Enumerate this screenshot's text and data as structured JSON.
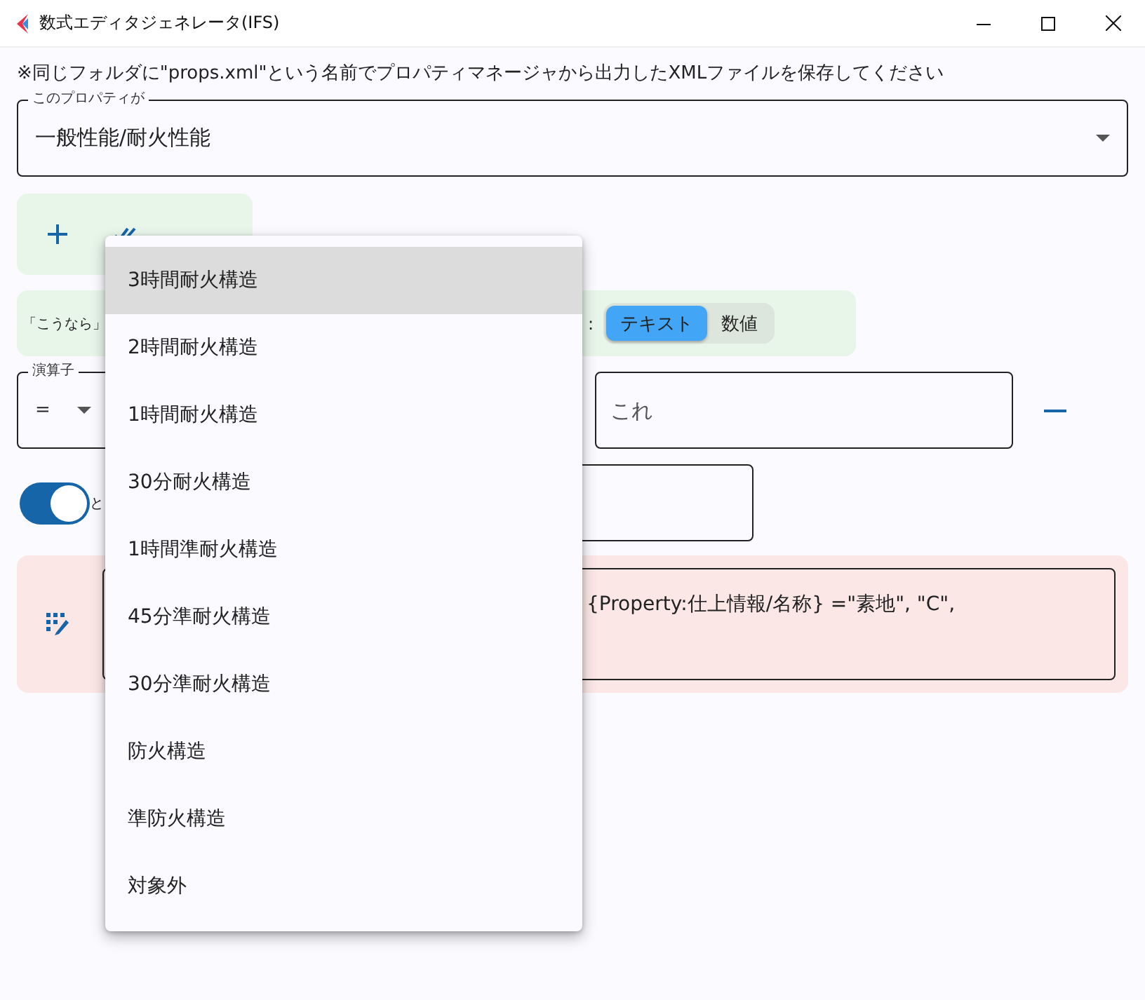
{
  "window": {
    "title": "数式エディタジェネレータ(IFS)"
  },
  "notice": "※同じフォルダに\"props.xml\"という名前でプロパティマネージャから出力したXMLファイルを保存してください",
  "property_select": {
    "label": "このプロパティが",
    "value": "一般性能/耐火性能"
  },
  "condition": {
    "label": "「こうなら」",
    "separator": ":",
    "value_type": [
      {
        "label": "テキスト",
        "selected": true
      },
      {
        "label": "数値",
        "selected": false
      }
    ]
  },
  "operator_select": {
    "label": "演算子",
    "value": "="
  },
  "value_field": {
    "placeholder": "これ"
  },
  "switch": {
    "on": true,
    "label": "と"
  },
  "formula": {
    "value": "{Property:仕上情報/名称} =\"素地\", \"C\","
  },
  "dropdown_menu": {
    "items": [
      {
        "label": "3時間耐火構造",
        "selected": true
      },
      {
        "label": "2時間耐火構造",
        "selected": false
      },
      {
        "label": "1時間耐火構造",
        "selected": false
      },
      {
        "label": "30分耐火構造",
        "selected": false
      },
      {
        "label": "1時間準耐火構造",
        "selected": false
      },
      {
        "label": "45分準耐火構造",
        "selected": false
      },
      {
        "label": "30分準耐火構造",
        "selected": false
      },
      {
        "label": "防火構造",
        "selected": false
      },
      {
        "label": "準防火構造",
        "selected": false
      },
      {
        "label": "対象外",
        "selected": false
      }
    ]
  }
}
